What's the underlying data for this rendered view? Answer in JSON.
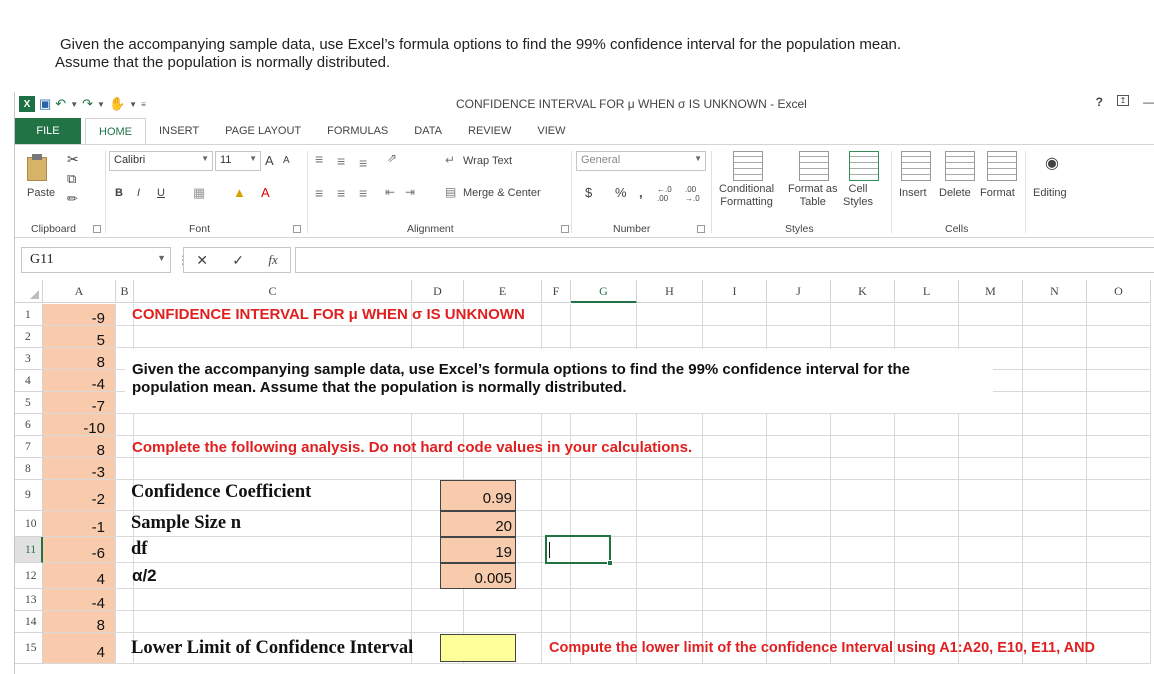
{
  "question": {
    "line1": "Given the accompanying sample data, use Excel’s formula options to find the 99% confidence interval for the population mean.",
    "line2": "Assume that the population is normally distributed."
  },
  "window": {
    "title": "CONFIDENCE INTERVAL FOR μ WHEN σ IS UNKNOWN - Excel",
    "help": "?",
    "qat": [
      "save-icon",
      "undo-icon",
      "redo-icon",
      "touch-mode-icon"
    ]
  },
  "tabs": [
    "FILE",
    "HOME",
    "INSERT",
    "PAGE LAYOUT",
    "FORMULAS",
    "DATA",
    "REVIEW",
    "VIEW"
  ],
  "active_tab": "HOME",
  "ribbon": {
    "clipboard": {
      "paste": "Paste",
      "label": "Clipboard"
    },
    "font": {
      "name": "Calibri",
      "size": "11",
      "bold": "B",
      "italic": "I",
      "underline": "U",
      "grow": "A",
      "shrink": "A",
      "label": "Font"
    },
    "alignment": {
      "wrap": "Wrap Text",
      "merge": "Merge & Center",
      "label": "Alignment"
    },
    "number": {
      "format": "General",
      "currency": "$",
      "percent": "%",
      "comma": ",",
      "inc_decimal": "←.0 .00",
      "dec_decimal": ".00 →.0",
      "label": "Number"
    },
    "styles": {
      "conditional": "Conditional",
      "conditional2": "Formatting",
      "format_as": "Format as",
      "table": "Table",
      "cell": "Cell",
      "cell_styles": "Styles",
      "label": "Styles"
    },
    "cells": {
      "insert": "Insert",
      "delete": "Delete",
      "format": "Format",
      "label": "Cells"
    },
    "editing": {
      "label": "Editing"
    }
  },
  "formula_bar": {
    "name_box": "G11",
    "fx": "fx",
    "cancel": "✕",
    "enter": "✓",
    "dots": "⋮",
    "value": ""
  },
  "columns": [
    "A",
    "B",
    "C",
    "D",
    "E",
    "F",
    "G",
    "H",
    "I",
    "J",
    "K",
    "L",
    "M",
    "N",
    "O"
  ],
  "selected_column": "G",
  "rows": [
    "1",
    "2",
    "3",
    "4",
    "5",
    "6",
    "7",
    "8",
    "9",
    "10",
    "11",
    "12",
    "13",
    "14",
    "15"
  ],
  "selected_row": "11",
  "sample_data": [
    "-9",
    "5",
    "8",
    "-4",
    "-7",
    "-10",
    "8",
    "-3",
    "-2",
    "-1",
    "-6",
    "4",
    "-4",
    "8",
    "4"
  ],
  "sheet": {
    "heading": "CONFIDENCE INTERVAL FOR μ WHEN σ IS UNKNOWN",
    "instructions_l1": "Given the accompanying sample data, use Excel’s formula options to find the 99% confidence interval for the",
    "instructions_l2": "population mean. Assume that the population is normally distributed.",
    "complete_note": "Complete the following analysis. Do not hard code values in your calculations.",
    "labels": {
      "confidence": "Confidence Coefficient",
      "sample_size": "Sample Size n",
      "df": "df",
      "alpha": "α/2",
      "lower": "Lower Limit of Confidence Interval"
    },
    "values": {
      "confidence": "0.99",
      "sample_size": "20",
      "df": "19",
      "alpha": "0.005"
    },
    "lower_note": "Compute the lower limit of the confidence Interval using A1:A20, E10, E11, AND"
  },
  "colors": {
    "excel_green": "#217346",
    "peach": "#f8cbad",
    "yellow": "#ffff99",
    "red": "#e02020"
  }
}
